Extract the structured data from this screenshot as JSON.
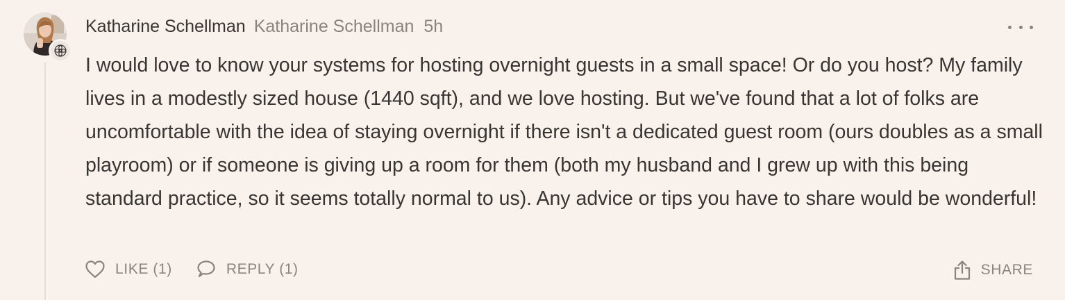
{
  "comment": {
    "author_name": "Katharine Schellman",
    "author_handle": "Katharine Schellman",
    "timestamp": "5h",
    "body": "I would love to know your systems for hosting overnight guests in a small space! Or do you host? My family lives in a modestly sized house (1440 sqft), and we love hosting. But we've found that a lot of folks are uncomfortable with the idea of staying overnight if there isn't a dedicated guest room (ours doubles as a small playroom) or if someone is giving up a room for them (both my husband and I grew up with this being standard practice, so it seems totally normal to us). Any advice or tips you have to share would be wonderful!",
    "avatar_icon": "user-avatar",
    "badge_icon": "flower-badge-icon",
    "more_icon": "more-dots-icon"
  },
  "actions": {
    "like_label": "LIKE (1)",
    "like_icon": "heart-icon",
    "reply_label": "REPLY (1)",
    "reply_icon": "speech-bubble-icon",
    "share_label": "SHARE",
    "share_icon": "share-icon"
  },
  "colors": {
    "background": "#f8f1ec",
    "text": "#3a3532",
    "muted": "#8a837f",
    "thread_line": "#e3dcd7"
  }
}
